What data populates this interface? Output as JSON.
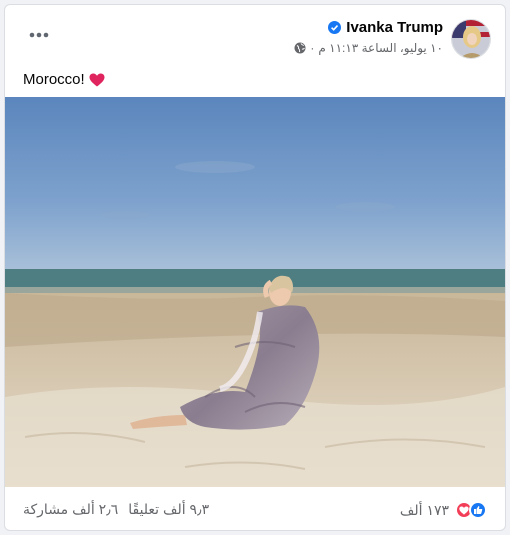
{
  "post": {
    "author": "Ivanka Trump",
    "timestamp": "١٠ يوليو، الساعة ١١:١٣ م",
    "meta_separator": "·",
    "caption_text": "Morocco!",
    "caption_emoji": "heart-emoji"
  },
  "footer": {
    "reactions_count": "١٧٣ ألف",
    "comments": "٩٫٣ ألف تعليقًا",
    "shares": "٢٫٦ ألف مشاركة"
  },
  "colors": {
    "accent": "#1877f2",
    "love": "#f33e58",
    "secondary_text": "#65676b"
  }
}
